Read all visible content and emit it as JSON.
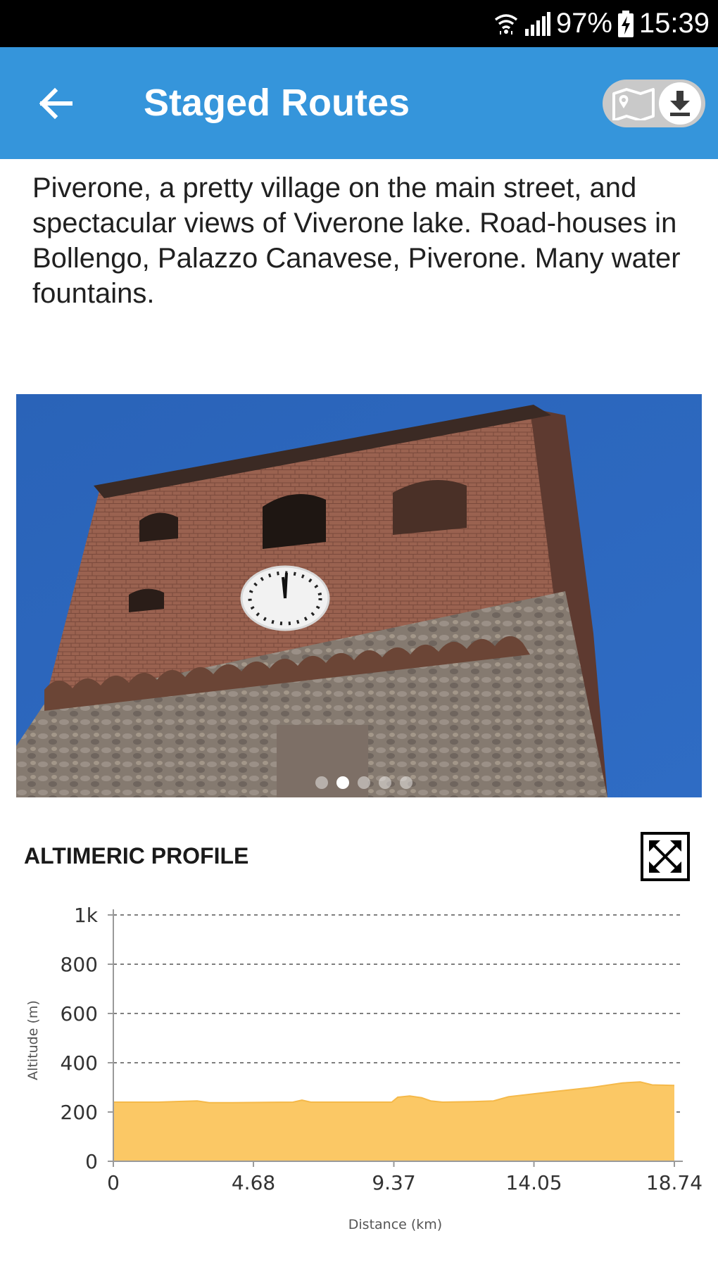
{
  "status_bar": {
    "battery": "97%",
    "time": "15:39"
  },
  "app_bar": {
    "title": "Staged Routes"
  },
  "description": "Piverone, a pretty village on the main street, and spectacular views of Viverone lake. Road-houses in Bollengo, Palazzo Canavese, Piverone. Many water fountains.",
  "gallery": {
    "dots": 5,
    "active_index": 1
  },
  "profile": {
    "title": "ALTIMERIC PROFILE"
  },
  "chart_data": {
    "type": "area",
    "xlabel": "Distance (km)",
    "ylabel": "Altitude (m)",
    "xlim": [
      0,
      18.74
    ],
    "ylim": [
      0,
      1000
    ],
    "x_ticks": [
      "0",
      "4.68",
      "9.37",
      "14.05",
      "18.74"
    ],
    "x_tick_values": [
      0,
      4.68,
      9.37,
      14.05,
      18.74
    ],
    "y_ticks": [
      "0",
      "200",
      "400",
      "600",
      "800",
      "1k"
    ],
    "y_tick_values": [
      0,
      200,
      400,
      600,
      800,
      1000
    ],
    "grid": "horizontal-dashed",
    "fill_color": "#fbc865",
    "line_color": "#f5b94a",
    "x": [
      0,
      1.5,
      2.2,
      2.8,
      3.2,
      4.0,
      6.0,
      6.3,
      6.6,
      7.0,
      9.3,
      9.5,
      9.9,
      10.3,
      10.6,
      11.0,
      12.0,
      12.7,
      13.2,
      14.5,
      16.0,
      17.0,
      17.6,
      18.0,
      18.74
    ],
    "y": [
      240,
      240,
      243,
      245,
      238,
      238,
      240,
      248,
      240,
      240,
      240,
      260,
      265,
      258,
      245,
      240,
      242,
      245,
      262,
      280,
      300,
      318,
      322,
      310,
      308
    ]
  }
}
